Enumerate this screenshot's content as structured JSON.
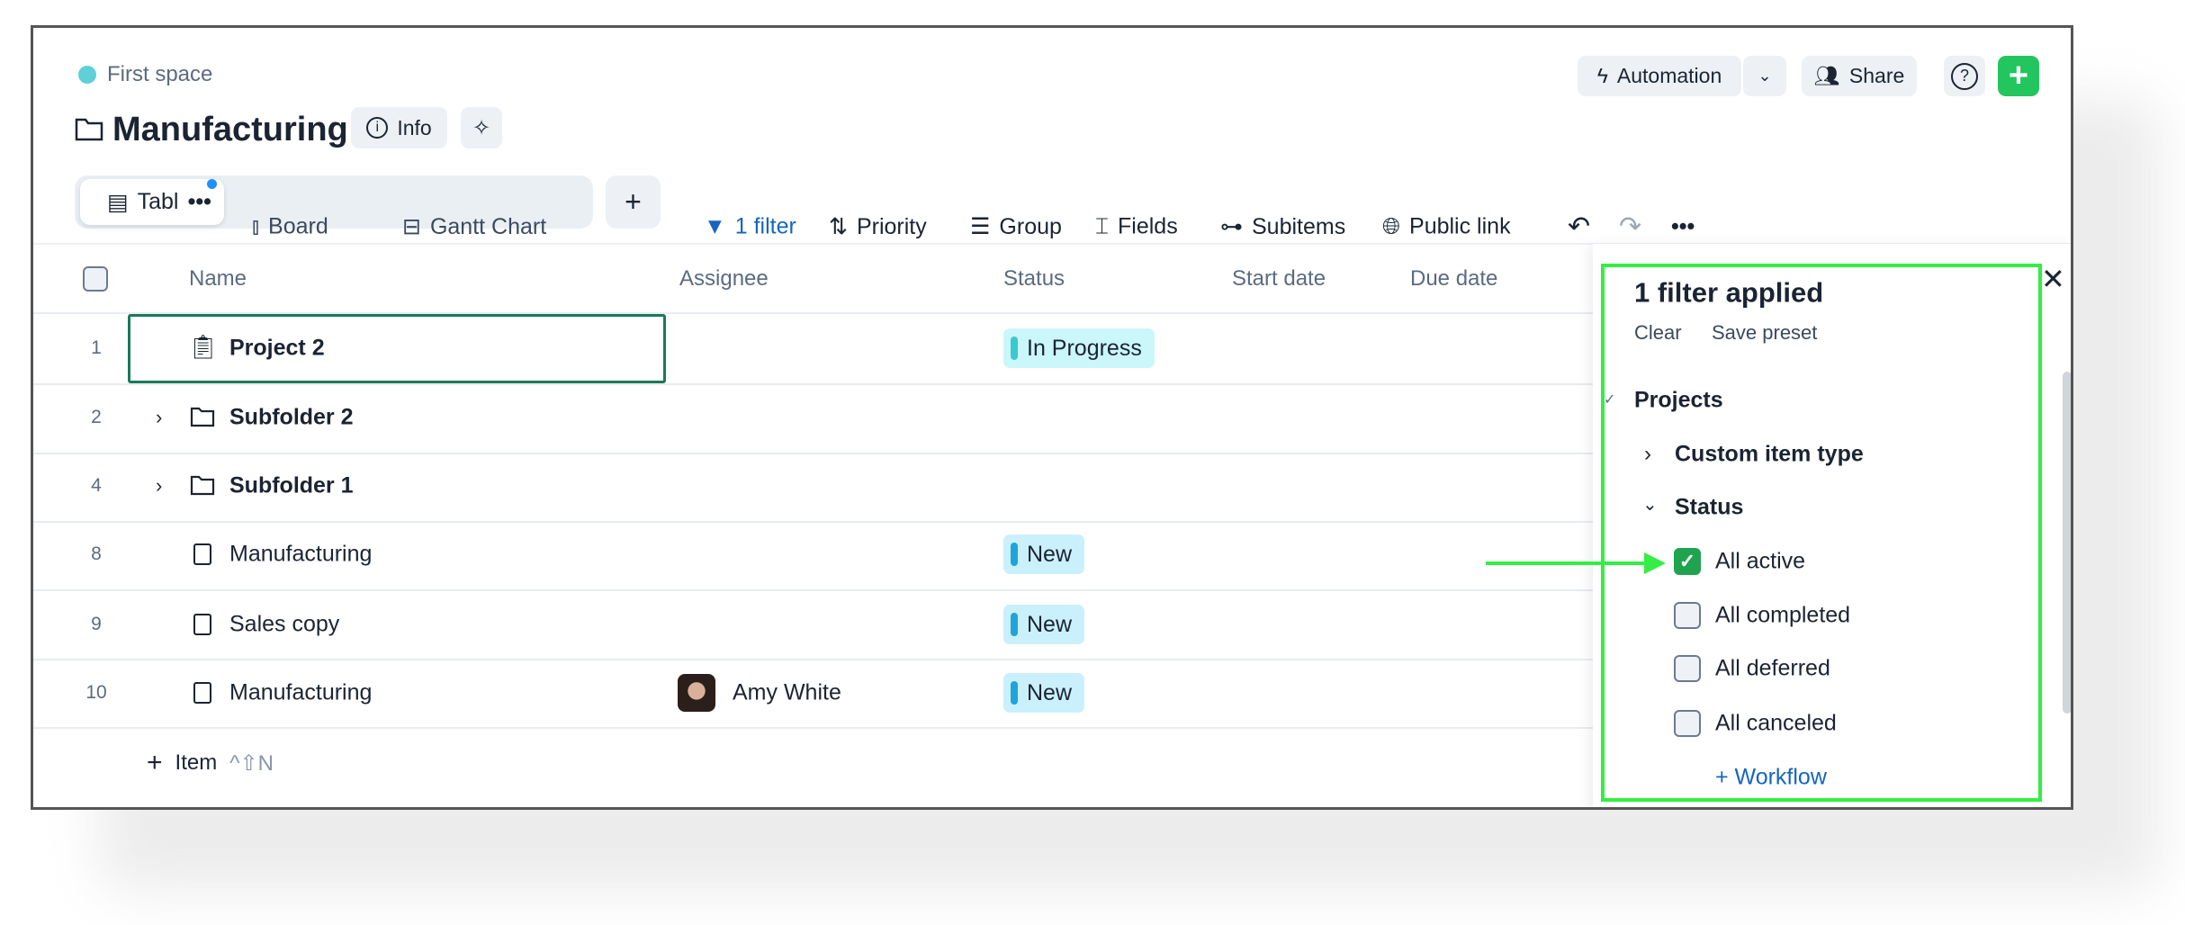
{
  "breadcrumb": {
    "space": "First space"
  },
  "header": {
    "title": "Manufacturing",
    "info_label": "Info",
    "automation_label": "Automation",
    "share_label": "Share"
  },
  "views": {
    "tabs": [
      {
        "label": "Table"
      },
      {
        "label": "Board"
      },
      {
        "label": "Gantt Chart"
      }
    ]
  },
  "toolbar": {
    "filter_label": "1 filter",
    "priority_label": "Priority",
    "group_label": "Group",
    "fields_label": "Fields",
    "subitems_label": "Subitems",
    "public_link_label": "Public link"
  },
  "table": {
    "columns": [
      "Name",
      "Assignee",
      "Status",
      "Start date",
      "Due date"
    ],
    "rows": [
      {
        "num": "1",
        "name": "Project 2",
        "type": "project",
        "assignee": "",
        "status": "In Progress",
        "status_color": "#3cc8d0"
      },
      {
        "num": "2",
        "name": "Subfolder 2",
        "type": "folder",
        "assignee": "",
        "status": ""
      },
      {
        "num": "4",
        "name": "Subfolder 1",
        "type": "folder",
        "assignee": "",
        "status": ""
      },
      {
        "num": "8",
        "name": "Manufacturing",
        "type": "doc",
        "assignee": "",
        "status": "New",
        "status_color": "#1fa3dc"
      },
      {
        "num": "9",
        "name": "Sales copy",
        "type": "doc",
        "assignee": "",
        "status": "New",
        "status_color": "#1fa3dc"
      },
      {
        "num": "10",
        "name": "Manufacturing",
        "type": "doc",
        "assignee": "Amy White",
        "status": "New",
        "status_color": "#1fa3dc"
      }
    ],
    "add_item_label": "Item",
    "add_item_shortcut": "^⇧N"
  },
  "filter_panel": {
    "title": "1 filter applied",
    "clear_label": "Clear",
    "save_preset_label": "Save preset",
    "section": "Projects",
    "custom_item_type": "Custom item type",
    "status_group": "Status",
    "options": [
      {
        "label": "All active",
        "checked": true
      },
      {
        "label": "All completed",
        "checked": false
      },
      {
        "label": "All deferred",
        "checked": false
      },
      {
        "label": "All canceled",
        "checked": false
      }
    ],
    "workflow_link": "+ Workflow"
  },
  "colors": {
    "accent_green": "#22c55e",
    "highlight": "#33ee44",
    "link_blue": "#1565c0",
    "selection": "#1a7a5a"
  }
}
